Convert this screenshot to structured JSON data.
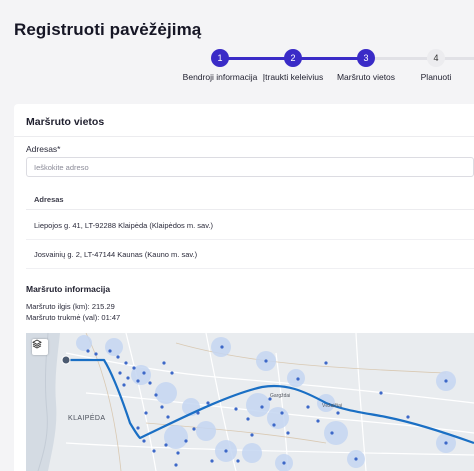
{
  "page": {
    "title": "Registruoti pavėžėjimą"
  },
  "stepper": {
    "steps": [
      {
        "number": "1",
        "label": "Bendroji informacija",
        "state": "done"
      },
      {
        "number": "2",
        "label": "Įtraukti keleivius",
        "state": "done"
      },
      {
        "number": "3",
        "label": "Maršruto vietos",
        "state": "done"
      },
      {
        "number": "4",
        "label": "Planuoti",
        "state": "todo"
      }
    ]
  },
  "route_section": {
    "title": "Maršruto vietos",
    "address_label": "Adresas*",
    "address_placeholder": "Ieškokite adreso",
    "address_value": "",
    "table": {
      "header": "Adresas",
      "rows": [
        "Liepojos g. 41, LT-92288 Klaipėda (Klaipėdos m. sav.)",
        "Josvainių g. 2, LT-47144 Kaunas (Kauno m. sav.)"
      ]
    }
  },
  "route_info": {
    "title": "Maršruto informacija",
    "distance": "Maršruto ilgis (km): 215.29",
    "duration": "Maršruto trukmė (val): 01:47"
  },
  "map": {
    "labels": {
      "city": "KLAIPĖDA",
      "town_1": "Gargždai",
      "town_2": "Vėžaičiai"
    },
    "colors": {
      "route": "#1a6fc4",
      "marker": "#3d68c8",
      "halo": "#c5d6f2",
      "land": "#e9ecef",
      "water": "#d4dbe3"
    },
    "icons": {
      "layers": "layers-icon",
      "start": "route-start-marker"
    }
  }
}
